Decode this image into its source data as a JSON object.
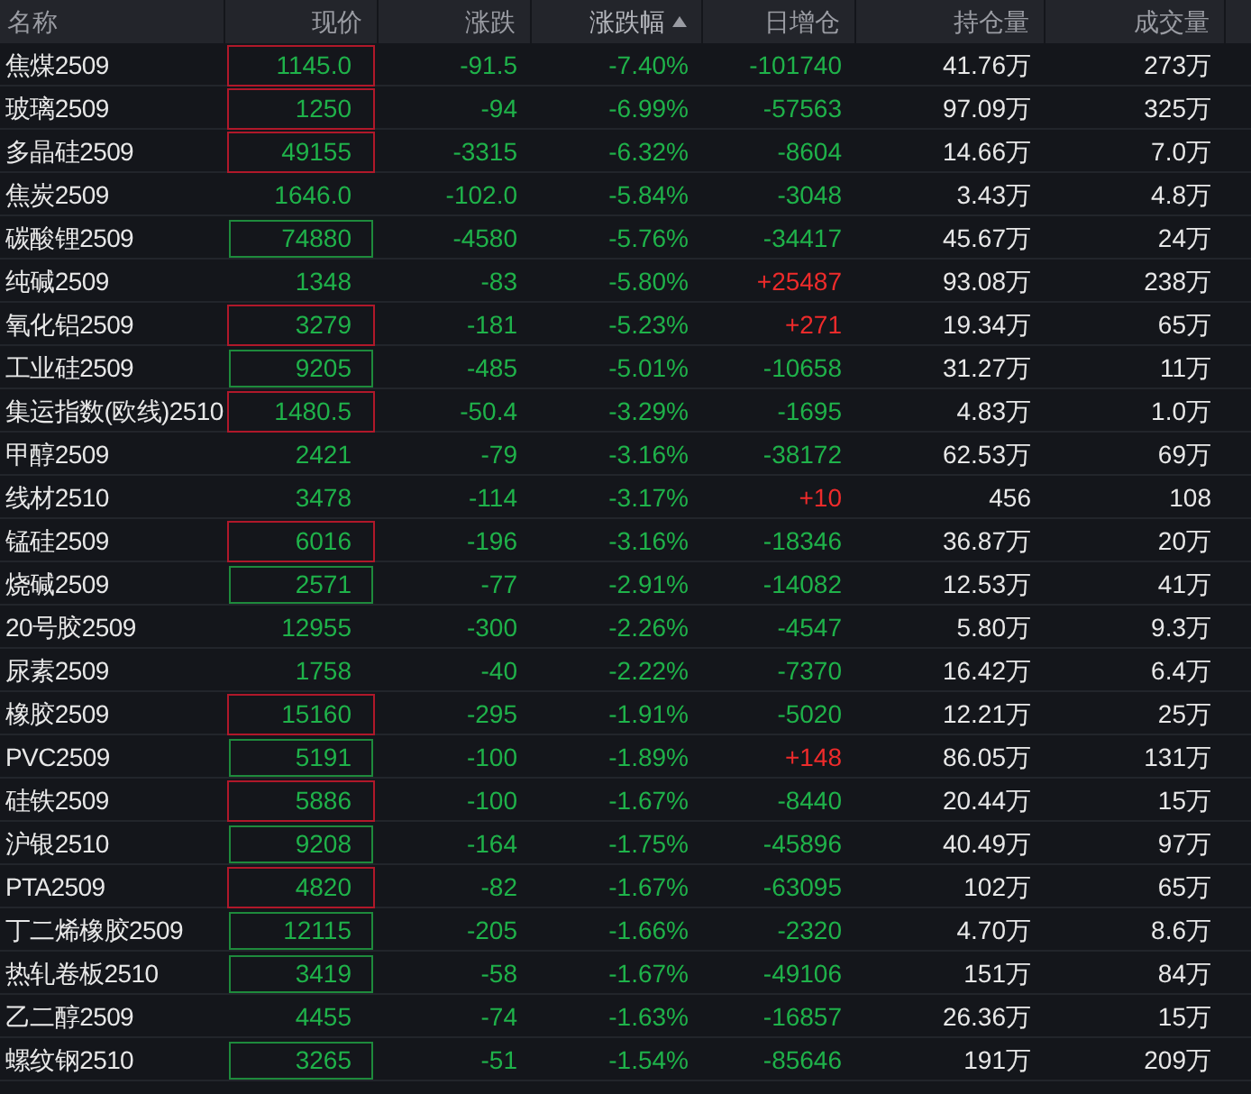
{
  "columns": [
    {
      "label": "名称",
      "sorted": false
    },
    {
      "label": "现价",
      "sorted": false
    },
    {
      "label": "涨跌",
      "sorted": false
    },
    {
      "label": "涨跌幅",
      "sorted": true
    },
    {
      "label": "日增仓",
      "sorted": false
    },
    {
      "label": "持仓量",
      "sorted": false
    },
    {
      "label": "成交量",
      "sorted": false
    }
  ],
  "rows": [
    {
      "name": "焦煤2509",
      "price": "1145.0",
      "change": "-91.5",
      "pct": "-7.40%",
      "oi_change": "-101740",
      "oi": "41.76万",
      "volume": "273万",
      "rising": false,
      "oi_rising": false,
      "tick_up": true,
      "tick_down": false
    },
    {
      "name": "玻璃2509",
      "price": "1250",
      "change": "-94",
      "pct": "-6.99%",
      "oi_change": "-57563",
      "oi": "97.09万",
      "volume": "325万",
      "rising": false,
      "oi_rising": false,
      "tick_up": true,
      "tick_down": false
    },
    {
      "name": "多晶硅2509",
      "price": "49155",
      "change": "-3315",
      "pct": "-6.32%",
      "oi_change": "-8604",
      "oi": "14.66万",
      "volume": "7.0万",
      "rising": false,
      "oi_rising": false,
      "tick_up": true,
      "tick_down": false
    },
    {
      "name": "焦炭2509",
      "price": "1646.0",
      "change": "-102.0",
      "pct": "-5.84%",
      "oi_change": "-3048",
      "oi": "3.43万",
      "volume": "4.8万",
      "rising": false,
      "oi_rising": false,
      "tick_up": false,
      "tick_down": false
    },
    {
      "name": "碳酸锂2509",
      "price": "74880",
      "change": "-4580",
      "pct": "-5.76%",
      "oi_change": "-34417",
      "oi": "45.67万",
      "volume": "24万",
      "rising": false,
      "oi_rising": false,
      "tick_up": false,
      "tick_down": true
    },
    {
      "name": "纯碱2509",
      "price": "1348",
      "change": "-83",
      "pct": "-5.80%",
      "oi_change": "+25487",
      "oi": "93.08万",
      "volume": "238万",
      "rising": false,
      "oi_rising": true,
      "tick_up": false,
      "tick_down": false
    },
    {
      "name": "氧化铝2509",
      "price": "3279",
      "change": "-181",
      "pct": "-5.23%",
      "oi_change": "+271",
      "oi": "19.34万",
      "volume": "65万",
      "rising": false,
      "oi_rising": true,
      "tick_up": true,
      "tick_down": false
    },
    {
      "name": "工业硅2509",
      "price": "9205",
      "change": "-485",
      "pct": "-5.01%",
      "oi_change": "-10658",
      "oi": "31.27万",
      "volume": "11万",
      "rising": false,
      "oi_rising": false,
      "tick_up": false,
      "tick_down": true
    },
    {
      "name": "集运指数(欧线)2510",
      "price": "1480.5",
      "change": "-50.4",
      "pct": "-3.29%",
      "oi_change": "-1695",
      "oi": "4.83万",
      "volume": "1.0万",
      "rising": false,
      "oi_rising": false,
      "tick_up": true,
      "tick_down": false
    },
    {
      "name": "甲醇2509",
      "price": "2421",
      "change": "-79",
      "pct": "-3.16%",
      "oi_change": "-38172",
      "oi": "62.53万",
      "volume": "69万",
      "rising": false,
      "oi_rising": false,
      "tick_up": false,
      "tick_down": false
    },
    {
      "name": "线材2510",
      "price": "3478",
      "change": "-114",
      "pct": "-3.17%",
      "oi_change": "+10",
      "oi": "456",
      "volume": "108",
      "rising": false,
      "oi_rising": true,
      "tick_up": false,
      "tick_down": false
    },
    {
      "name": "锰硅2509",
      "price": "6016",
      "change": "-196",
      "pct": "-3.16%",
      "oi_change": "-18346",
      "oi": "36.87万",
      "volume": "20万",
      "rising": false,
      "oi_rising": false,
      "tick_up": true,
      "tick_down": false
    },
    {
      "name": "烧碱2509",
      "price": "2571",
      "change": "-77",
      "pct": "-2.91%",
      "oi_change": "-14082",
      "oi": "12.53万",
      "volume": "41万",
      "rising": false,
      "oi_rising": false,
      "tick_up": false,
      "tick_down": true
    },
    {
      "name": "20号胶2509",
      "price": "12955",
      "change": "-300",
      "pct": "-2.26%",
      "oi_change": "-4547",
      "oi": "5.80万",
      "volume": "9.3万",
      "rising": false,
      "oi_rising": false,
      "tick_up": false,
      "tick_down": false
    },
    {
      "name": "尿素2509",
      "price": "1758",
      "change": "-40",
      "pct": "-2.22%",
      "oi_change": "-7370",
      "oi": "16.42万",
      "volume": "6.4万",
      "rising": false,
      "oi_rising": false,
      "tick_up": false,
      "tick_down": false
    },
    {
      "name": "橡胶2509",
      "price": "15160",
      "change": "-295",
      "pct": "-1.91%",
      "oi_change": "-5020",
      "oi": "12.21万",
      "volume": "25万",
      "rising": false,
      "oi_rising": false,
      "tick_up": true,
      "tick_down": false
    },
    {
      "name": "PVC2509",
      "price": "5191",
      "change": "-100",
      "pct": "-1.89%",
      "oi_change": "+148",
      "oi": "86.05万",
      "volume": "131万",
      "rising": false,
      "oi_rising": true,
      "tick_up": false,
      "tick_down": true
    },
    {
      "name": "硅铁2509",
      "price": "5886",
      "change": "-100",
      "pct": "-1.67%",
      "oi_change": "-8440",
      "oi": "20.44万",
      "volume": "15万",
      "rising": false,
      "oi_rising": false,
      "tick_up": true,
      "tick_down": false
    },
    {
      "name": "沪银2510",
      "price": "9208",
      "change": "-164",
      "pct": "-1.75%",
      "oi_change": "-45896",
      "oi": "40.49万",
      "volume": "97万",
      "rising": false,
      "oi_rising": false,
      "tick_up": false,
      "tick_down": true
    },
    {
      "name": "PTA2509",
      "price": "4820",
      "change": "-82",
      "pct": "-1.67%",
      "oi_change": "-63095",
      "oi": "102万",
      "volume": "65万",
      "rising": false,
      "oi_rising": false,
      "tick_up": true,
      "tick_down": false
    },
    {
      "name": "丁二烯橡胶2509",
      "price": "12115",
      "change": "-205",
      "pct": "-1.66%",
      "oi_change": "-2320",
      "oi": "4.70万",
      "volume": "8.6万",
      "rising": false,
      "oi_rising": false,
      "tick_up": false,
      "tick_down": true
    },
    {
      "name": "热轧卷板2510",
      "price": "3419",
      "change": "-58",
      "pct": "-1.67%",
      "oi_change": "-49106",
      "oi": "151万",
      "volume": "84万",
      "rising": false,
      "oi_rising": false,
      "tick_up": false,
      "tick_down": true
    },
    {
      "name": "乙二醇2509",
      "price": "4455",
      "change": "-74",
      "pct": "-1.63%",
      "oi_change": "-16857",
      "oi": "26.36万",
      "volume": "15万",
      "rising": false,
      "oi_rising": false,
      "tick_up": false,
      "tick_down": false
    },
    {
      "name": "螺纹钢2510",
      "price": "3265",
      "change": "-51",
      "pct": "-1.54%",
      "oi_change": "-85646",
      "oi": "191万",
      "volume": "209万",
      "rising": false,
      "oi_rising": false,
      "tick_up": false,
      "tick_down": true
    }
  ]
}
